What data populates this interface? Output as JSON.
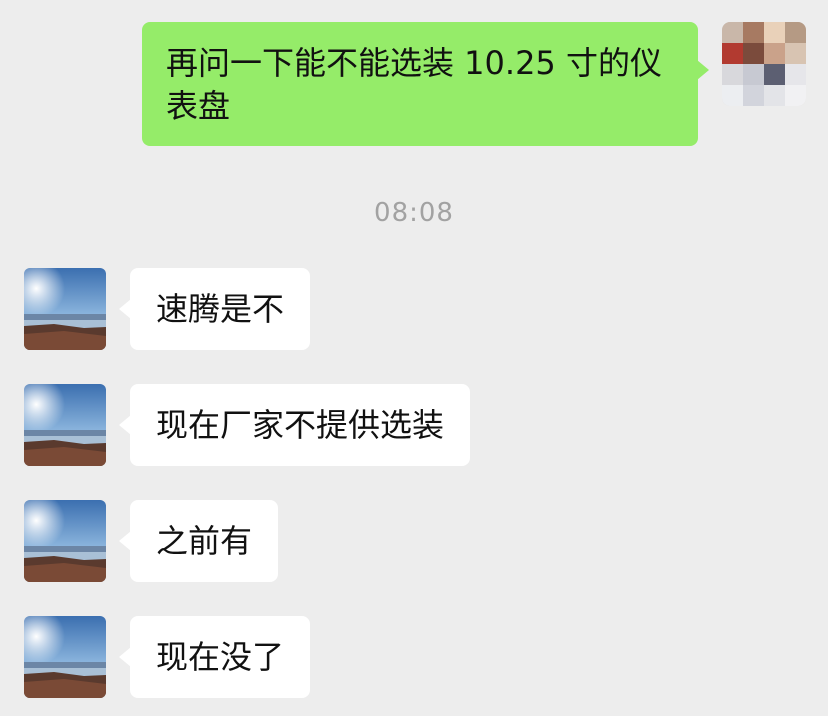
{
  "conversation": {
    "self": {
      "message": "再问一下能不能选装 10.25 寸的仪表盘",
      "bubble_color": "#95ec69"
    },
    "timestamp": "08:08",
    "incoming": [
      {
        "text": "速腾是不"
      },
      {
        "text": "现在厂家不提供选装"
      },
      {
        "text": "之前有"
      },
      {
        "text": "现在没了"
      }
    ],
    "colors": {
      "background": "#ededed",
      "incoming_bubble": "#ffffff",
      "timestamp_text": "#a2a2a2"
    }
  }
}
